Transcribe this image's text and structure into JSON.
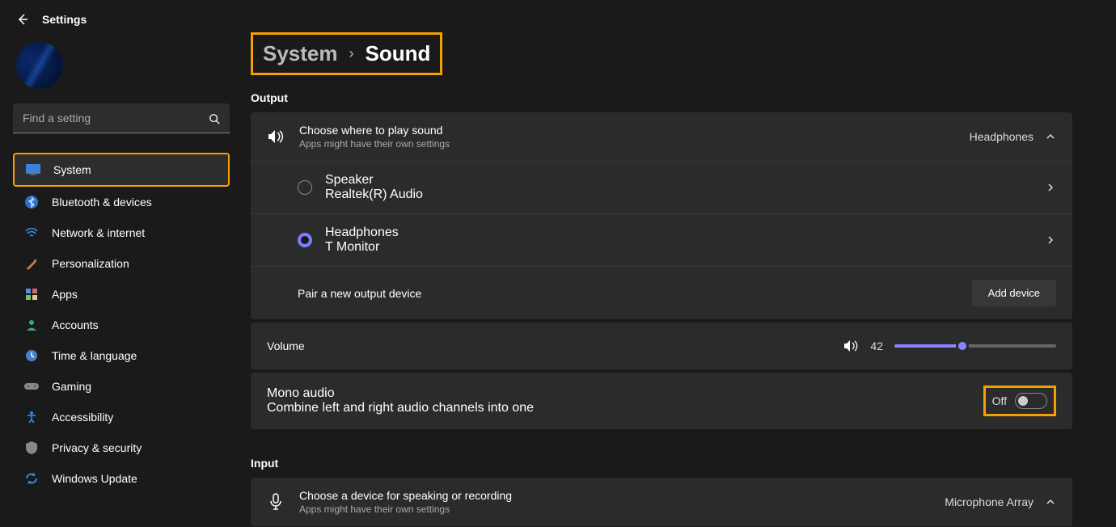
{
  "header": {
    "title": "Settings"
  },
  "search": {
    "placeholder": "Find a setting"
  },
  "sidebar": {
    "items": [
      {
        "label": "System"
      },
      {
        "label": "Bluetooth & devices"
      },
      {
        "label": "Network & internet"
      },
      {
        "label": "Personalization"
      },
      {
        "label": "Apps"
      },
      {
        "label": "Accounts"
      },
      {
        "label": "Time & language"
      },
      {
        "label": "Gaming"
      },
      {
        "label": "Accessibility"
      },
      {
        "label": "Privacy & security"
      },
      {
        "label": "Windows Update"
      }
    ]
  },
  "breadcrumb": {
    "parent": "System",
    "page": "Sound"
  },
  "output": {
    "label": "Output",
    "choose": {
      "title": "Choose where to play sound",
      "sub": "Apps might have their own settings",
      "value": "Headphones"
    },
    "devices": [
      {
        "name": "Speaker",
        "sub": "Realtek(R) Audio",
        "selected": false
      },
      {
        "name": "Headphones",
        "sub": "T Monitor",
        "selected": true
      }
    ],
    "pair": {
      "label": "Pair a new output device",
      "button": "Add device"
    }
  },
  "volume": {
    "label": "Volume",
    "value": "42",
    "percent": 42
  },
  "mono": {
    "title": "Mono audio",
    "sub": "Combine left and right audio channels into one",
    "state": "Off"
  },
  "input": {
    "label": "Input",
    "choose": {
      "title": "Choose a device for speaking or recording",
      "sub": "Apps might have their own settings",
      "value": "Microphone Array"
    }
  }
}
